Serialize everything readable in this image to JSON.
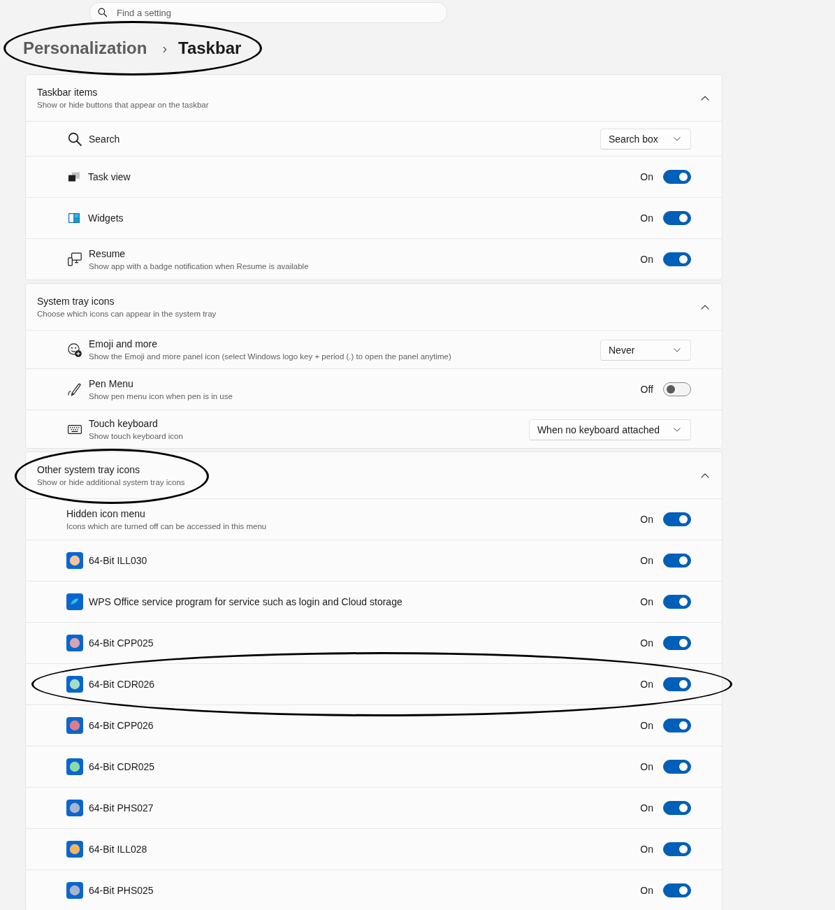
{
  "search": {
    "placeholder": "Find a setting"
  },
  "breadcrumb": {
    "parent": "Personalization",
    "separator": "›",
    "current": "Taskbar",
    "circled": true
  },
  "sections": [
    {
      "title": "Taskbar items",
      "subtitle": "Show or hide buttons that appear on the taskbar",
      "expanded": true,
      "circled": false,
      "rows": [
        {
          "kind": "dropdown",
          "label": "Search",
          "value": "Search box",
          "circled": false
        },
        {
          "kind": "toggle",
          "label": "Task view",
          "state_label": "On",
          "on": true,
          "circled": false
        },
        {
          "kind": "toggle",
          "label": "Widgets",
          "state_label": "On",
          "on": true,
          "circled": false
        },
        {
          "kind": "toggle",
          "label": "Resume",
          "description": "Show app with a badge notification when Resume is available",
          "state_label": "On",
          "on": true,
          "circled": false
        }
      ]
    },
    {
      "title": "System tray icons",
      "subtitle": "Choose which icons can appear in the system tray",
      "expanded": true,
      "circled": false,
      "rows": [
        {
          "kind": "dropdown",
          "label": "Emoji and more",
          "description": "Show the Emoji and more panel icon (select Windows logo key + period (.) to open the panel anytime)",
          "value": "Never",
          "circled": false
        },
        {
          "kind": "toggle",
          "label": "Pen Menu",
          "description": "Show pen menu icon when pen is in use",
          "state_label": "Off",
          "on": false,
          "circled": false
        },
        {
          "kind": "dropdown",
          "label": "Touch keyboard",
          "description": "Show touch keyboard icon",
          "value": "When no keyboard attached",
          "circled": false
        }
      ]
    },
    {
      "title": "Other system tray icons",
      "subtitle": "Show or hide additional system tray icons",
      "expanded": true,
      "circled": true,
      "rows": [
        {
          "kind": "toggle",
          "label": "Hidden icon menu",
          "description": "Icons which are turned off can be accessed in this menu",
          "state_label": "On",
          "on": true,
          "circled": false
        },
        {
          "kind": "toggle",
          "label": "64-Bit ILL030",
          "color": "#f5c49e",
          "state_label": "On",
          "on": true,
          "circled": false
        },
        {
          "kind": "toggle",
          "label": "WPS Office service program for service such as login and Cloud storage",
          "state_label": "On",
          "on": true,
          "circled": false
        },
        {
          "kind": "toggle",
          "label": "64-Bit CPP025",
          "color": "#d9a3b4",
          "state_label": "On",
          "on": true,
          "circled": false
        },
        {
          "kind": "toggle",
          "label": "64-Bit CDR026",
          "color": "#a8dcc2",
          "state_label": "On",
          "on": true,
          "circled": true
        },
        {
          "kind": "toggle",
          "label": "64-Bit CPP026",
          "color": "#e07c88",
          "state_label": "On",
          "on": true,
          "circled": false
        },
        {
          "kind": "toggle",
          "label": "64-Bit CDR025",
          "color": "#8fd8aa",
          "state_label": "On",
          "on": true,
          "circled": false
        },
        {
          "kind": "toggle",
          "label": "64-Bit PHS027",
          "color": "#aab5cc",
          "state_label": "On",
          "on": true,
          "circled": false
        },
        {
          "kind": "toggle",
          "label": "64-Bit ILL028",
          "color": "#f6b55c",
          "state_label": "On",
          "on": true,
          "circled": false
        },
        {
          "kind": "toggle",
          "label": "64-Bit PHS025",
          "color": "#aab5cc",
          "state_label": "On",
          "on": true,
          "circled": false
        }
      ]
    }
  ]
}
